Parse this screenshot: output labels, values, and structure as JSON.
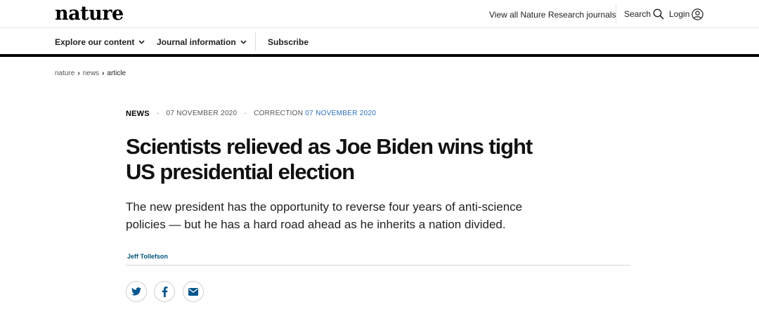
{
  "header": {
    "logo": "nature",
    "journals_link": "View all Nature Research journals",
    "search_label": "Search",
    "login_label": "Login"
  },
  "subnav": {
    "explore": "Explore our content",
    "journal_info": "Journal information",
    "subscribe": "Subscribe"
  },
  "breadcrumb": {
    "items": [
      "nature",
      "news",
      "article"
    ]
  },
  "article": {
    "type": "NEWS",
    "date": "07 NOVEMBER 2020",
    "correction_label": "CORRECTION",
    "correction_date": "07 NOVEMBER 2020",
    "title_line1": "Scientists relieved as Joe Biden wins tight",
    "title_line2": "US presidential election",
    "standfirst_line1": "The new president has the opportunity to reverse four years of anti-science",
    "standfirst_line2": "policies — but he has a hard road ahead as he inherits a nation divided.",
    "author": "Jeff Tollefson"
  },
  "share": {
    "twitter_icon": "twitter-icon",
    "facebook_icon": "facebook-icon",
    "email_icon": "email-icon"
  },
  "colors": {
    "link_blue": "#2a6ebb",
    "author_blue": "#00557a",
    "icon_blue": "#00558c"
  }
}
